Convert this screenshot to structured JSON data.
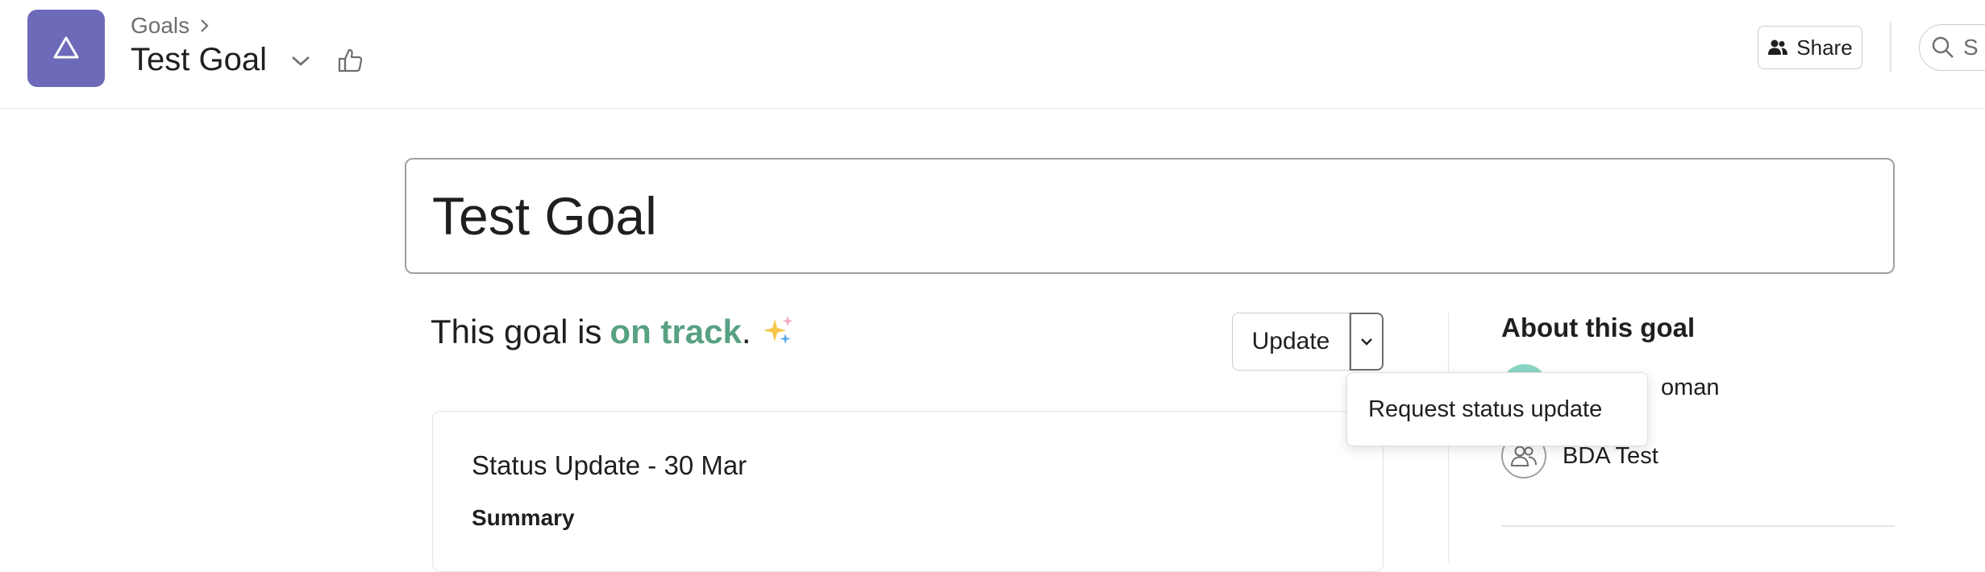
{
  "header": {
    "breadcrumb": "Goals",
    "title": "Test Goal",
    "share_label": "Share",
    "search_placeholder": "S"
  },
  "goal": {
    "title": "Test Goal",
    "status_prefix": "This goal is",
    "status_value": "on track",
    "status_suffix": ".",
    "status_color": "#58a182"
  },
  "actions": {
    "update_label": "Update",
    "dropdown_item": "Request status update"
  },
  "status_card": {
    "title": "Status Update - 30 Mar",
    "summary_heading": "Summary"
  },
  "about": {
    "heading": "About this goal",
    "owner_name_visible": "oman",
    "team_name": "BDA Test"
  },
  "colors": {
    "app_icon": "#6d6aba",
    "on_track": "#58a182"
  }
}
